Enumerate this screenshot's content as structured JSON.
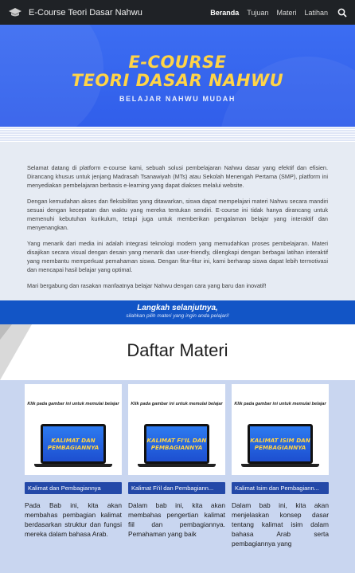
{
  "nav": {
    "brand": "E-Course Teori Dasar Nahwu",
    "items": [
      "Beranda",
      "Tujuan",
      "Materi",
      "Latihan"
    ]
  },
  "hero": {
    "title_line1": "E-COURSE",
    "title_line2": "TEORI DASAR NAHWU",
    "subtitle": "BELAJAR NAHWU MUDAH"
  },
  "intro": {
    "p1": "Selamat datang di platform e-course kami, sebuah solusi pembelajaran Nahwu dasar yang efektif dan efisien. Dirancang khusus untuk jenjang Madrasah Tsanawiyah (MTs) atau Sekolah Menengah Pertama (SMP), platform ini menyediakan pembelajaran berbasis e-learning yang dapat diakses melalui website.",
    "p2": "Dengan kemudahan akses dan fleksibilitas yang ditawarkan, siswa dapat mempelajari materi Nahwu secara mandiri sesuai dengan kecepatan dan waktu yang mereka tentukan sendiri. E-course ini tidak hanya dirancang untuk memenuhi kebutuhan kurikulum, tetapi juga untuk memberikan pengalaman belajar yang interaktif dan menyenangkan.",
    "p3": "Yang menarik dari media ini adalah integrasi teknologi modern yang memudahkan proses pembelajaran. Materi disajikan secara visual dengan desain yang menarik dan user-friendly, dilengkapi dengan berbagai latihan interaktif yang membantu memperkuat pemahaman siswa. Dengan fitur-fitur ini, kami berharap siswa dapat lebih termotivasi dan mencapai hasil belajar yang optimal.",
    "p4": "Mari bergabung dan rasakan manfaatnya belajar Nahwu dengan cara yang baru dan inovatif!"
  },
  "band": {
    "title": "Langkah selanjutnya,",
    "subtitle": "silahkan pilih materi yang ingin anda pelajari!"
  },
  "daftar": {
    "title": "Daftar Materi"
  },
  "cards": [
    {
      "hint": "Klik pada gambar ini untuk memulai belajar",
      "screen_line1": "KALIMAT DAN",
      "screen_line2": "PEMBAGIANNYA",
      "label": "Kalimat dan Pembagiannya",
      "desc": "Pada Bab ini, kita akan membahas pembagian kalimat berdasarkan struktur dan fungsi mereka dalam bahasa Arab."
    },
    {
      "hint": "Klik pada gambar ini untuk memulai belajar",
      "screen_line1": "KALIMAT FI'IL DAN",
      "screen_line2": "PEMBAGIANNYA",
      "label": "Kalimat Fi'il dan Pembagiann...",
      "desc": "Dalam bab ini, kita akan membahas pengertian kalimat fiil dan pembagiannya. Pemahaman yang baik"
    },
    {
      "hint": "Klik pada gambar ini untuk memulai belajar",
      "screen_line1": "KALIMAT ISIM DAN",
      "screen_line2": "PEMBAGIANNYA",
      "label": "Kalimat Isim dan Pembagiann...",
      "desc": "Dalam bab ini, kita akan menjelaskan konsep dasar tentang kalimat isim dalam bahasa Arab serta pembagiannya yang"
    }
  ]
}
